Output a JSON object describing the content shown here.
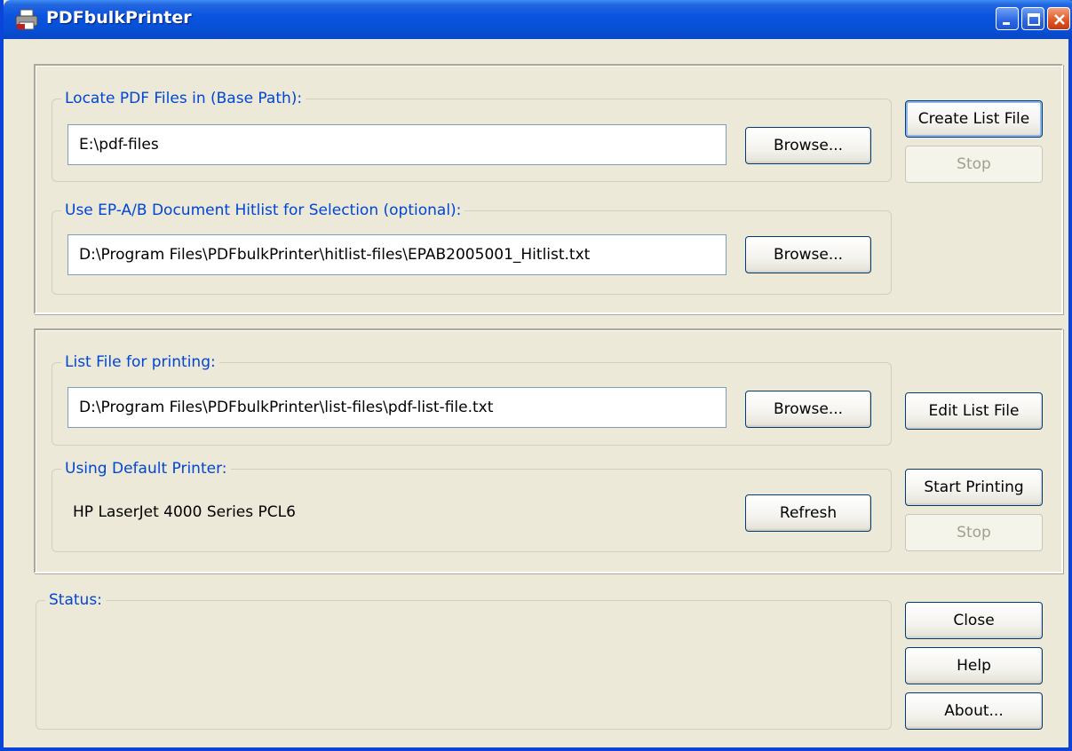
{
  "window": {
    "title": "PDFbulkPrinter"
  },
  "section1": {
    "base_path_label": "Locate PDF Files in (Base Path):",
    "base_path_value": "E:\\pdf-files",
    "browse1": "Browse...",
    "hitlist_label": "Use EP-A/B Document Hitlist for Selection (optional):",
    "hitlist_value": "D:\\Program Files\\PDFbulkPrinter\\hitlist-files\\EPAB2005001_Hitlist.txt",
    "browse2": "Browse...",
    "create_list": "Create List File",
    "stop": "Stop"
  },
  "section2": {
    "list_file_label": "List File for printing:",
    "list_file_value": "D:\\Program Files\\PDFbulkPrinter\\list-files\\pdf-list-file.txt",
    "browse3": "Browse...",
    "edit_list": "Edit List File",
    "printer_label": "Using Default Printer:",
    "printer_name": "HP LaserJet 4000 Series PCL6",
    "refresh": "Refresh",
    "start_printing": "Start Printing",
    "stop": "Stop"
  },
  "status": {
    "label": "Status:",
    "close": "Close",
    "help": "Help",
    "about": "About..."
  },
  "colors": {
    "face": "#ECE9D8",
    "group_label": "#0046D5",
    "titlebar": "#0A55E0"
  }
}
